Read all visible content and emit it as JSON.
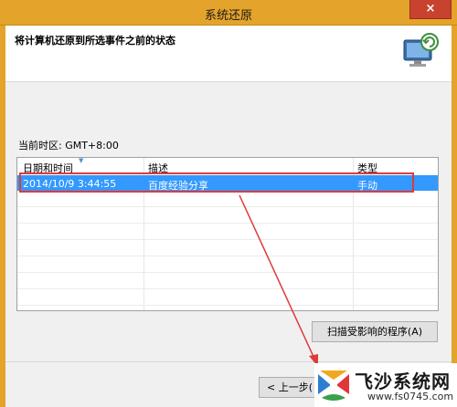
{
  "window": {
    "title": "系统还原",
    "close_label": "×"
  },
  "header": {
    "heading": "将计算机还原到所选事件之前的状态"
  },
  "timezone": {
    "label": "当前时区: GMT+8:00"
  },
  "table": {
    "columns": [
      "日期和时间",
      "描述",
      "类型"
    ],
    "rows": [
      {
        "datetime": "2014/10/9 3:44:55",
        "description": "百度经验分享",
        "type": "手动",
        "selected": true
      }
    ]
  },
  "buttons": {
    "scan_label": "扫描受影响的程序(A)",
    "prev_label": "< 上一步("
  },
  "watermark": {
    "title": "飞沙系统网",
    "url": "www.fs0745.com"
  },
  "colors": {
    "title_bar": "#e4a32a",
    "selection": "#3399ff",
    "annotation": "#e03a3a"
  }
}
